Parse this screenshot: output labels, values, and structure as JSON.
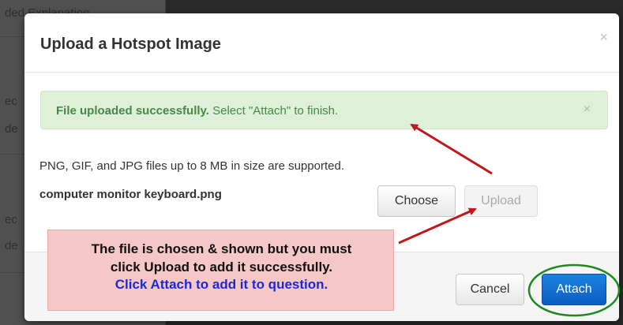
{
  "modal": {
    "title": "Upload a Hotspot Image",
    "close_icon": "×"
  },
  "alert": {
    "strong_text": "File uploaded successfully.",
    "text": " Select \"Attach\" to finish.",
    "close_icon": "×"
  },
  "body": {
    "support_text": "PNG, GIF, and JPG files up to 8 MB in size are supported.",
    "filename": "computer monitor keyboard.png",
    "choose_label": "Choose",
    "upload_label": "Upload"
  },
  "footer": {
    "cancel_label": "Cancel",
    "attach_label": "Attach"
  },
  "annotation": {
    "line1": "The file is chosen & shown but you must",
    "line2": "click Upload to add it successfully.",
    "line3": "Click Attach to add it to question."
  },
  "background": {
    "fragment_1": "ded Explanation",
    "fragment_2": "ec",
    "fragment_3": "de",
    "fragment_4": "ec",
    "fragment_5": "de"
  },
  "colors": {
    "alert_bg": "#dff0d8",
    "alert_text": "#468847",
    "annotation_bg": "#f5c7c7",
    "annotation_highlight": "#1a2ad8",
    "attach_button": "#0d5cc2",
    "arrow": "#c0171b",
    "circle": "#1e8a1e"
  }
}
